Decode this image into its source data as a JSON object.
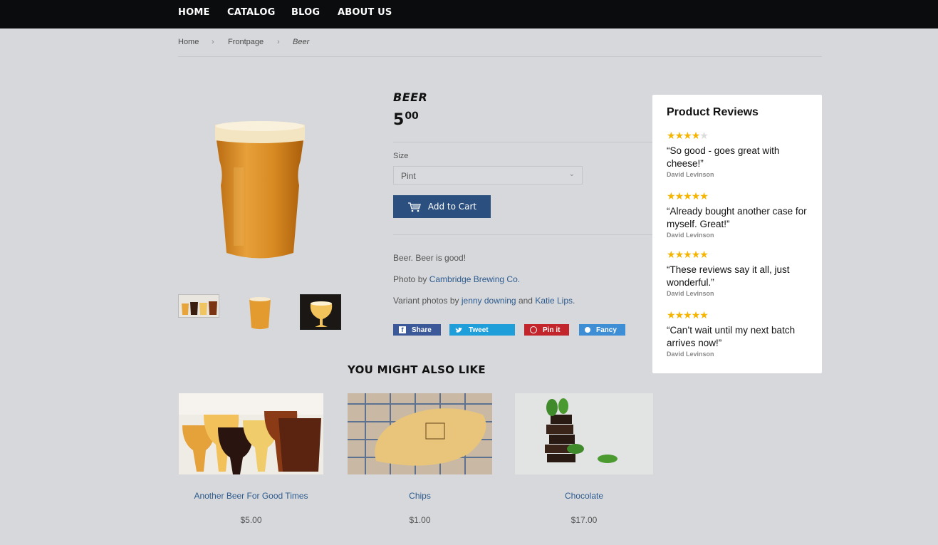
{
  "nav": {
    "items": [
      "HOME",
      "CATALOG",
      "BLOG",
      "ABOUT US"
    ]
  },
  "breadcrumb": {
    "home": "Home",
    "frontpage": "Frontpage",
    "current": "Beer",
    "separator": "›"
  },
  "product": {
    "title": "BEER",
    "price_main": "5",
    "price_cents": "00",
    "size_label": "Size",
    "size_value": "Pint",
    "add_to_cart": "Add to Cart",
    "description": "Beer. Beer is good!",
    "photo_prefix": "Photo by",
    "photo_credit": "Cambridge Brewing Co.",
    "variant_prefix": "Variant photos by",
    "variant_credit_1": "jenny downing",
    "variant_and": "and",
    "variant_credit_2": "Katie Lips",
    "variant_suffix": "."
  },
  "social": {
    "share": "Share",
    "tweet": "Tweet",
    "pin": "Pin it",
    "fancy": "Fancy"
  },
  "related": {
    "title": "YOU MIGHT ALSO LIKE",
    "items": [
      {
        "name": "Another Beer For Good Times",
        "price": "$5.00"
      },
      {
        "name": "Chips",
        "price": "$1.00"
      },
      {
        "name": "Chocolate",
        "price": "$17.00"
      }
    ]
  },
  "reviews": {
    "title": "Product Reviews",
    "items": [
      {
        "rating": 4,
        "text": "“So good - goes great with cheese!”",
        "author": "David Levinson"
      },
      {
        "rating": 5,
        "text": "“Already bought another case for myself. Great!”",
        "author": "David Levinson"
      },
      {
        "rating": 5,
        "text": "“These reviews say it all, just wonderful.”",
        "author": "David Levinson"
      },
      {
        "rating": 5,
        "text": "“Can’t wait until my next batch arrives now!”",
        "author": "David Levinson"
      }
    ]
  },
  "colors": {
    "nav_bg": "#0b0c0e",
    "button": "#2b4f7e",
    "link": "#2c5b8f",
    "star": "#f5b400",
    "share": "#3b5998",
    "tweet": "#1f9fd9",
    "pin": "#c2252b",
    "fancy": "#3d8ed4"
  }
}
